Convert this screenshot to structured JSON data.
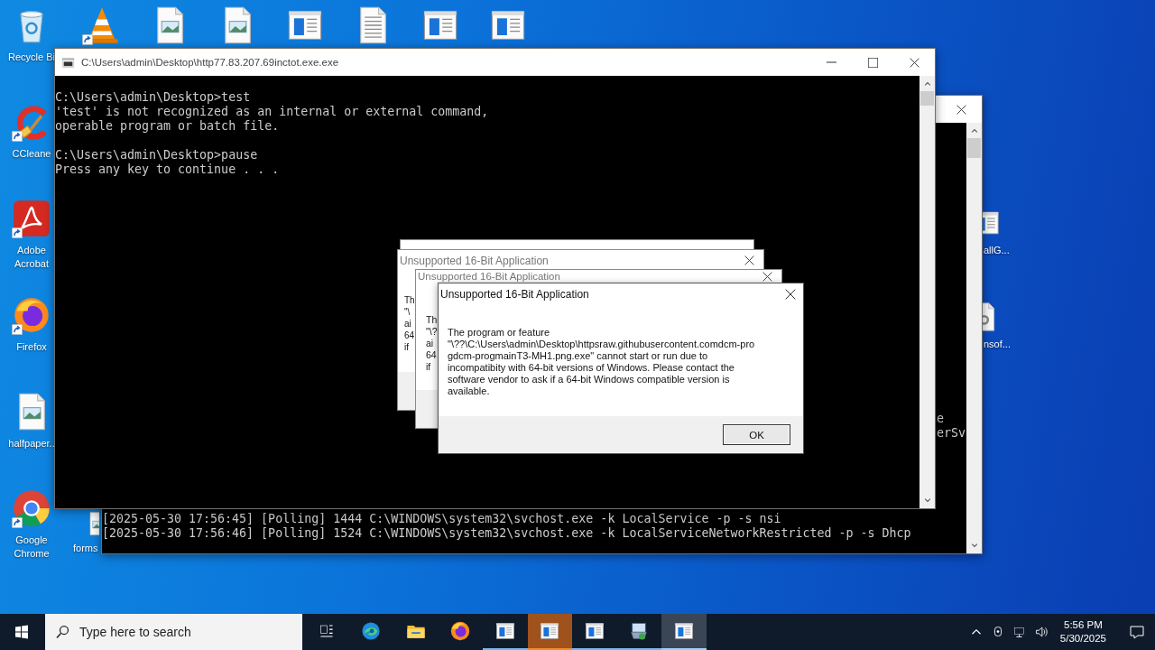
{
  "desktop_icons": [
    {
      "label": "Recycle Bi",
      "kind": "recycle",
      "shortcut": false
    },
    {
      "label": "CCleane",
      "kind": "ccleaner",
      "shortcut": true
    },
    {
      "label": "Adobe Acrobat",
      "kind": "acrobat",
      "shortcut": true
    },
    {
      "label": "Firefox",
      "kind": "firefox",
      "shortcut": true
    },
    {
      "label": "halfpaper..",
      "kind": "image",
      "shortcut": false
    },
    {
      "label": "Google Chrome",
      "kind": "chrome",
      "shortcut": true
    }
  ],
  "top_icons": [
    {
      "kind": "vlc",
      "shortcut": true
    },
    {
      "kind": "image",
      "shortcut": false
    },
    {
      "kind": "image",
      "shortcut": false
    },
    {
      "kind": "window",
      "shortcut": false
    },
    {
      "kind": "document",
      "shortcut": false
    },
    {
      "kind": "window",
      "shortcut": false
    },
    {
      "kind": "window",
      "shortcut": false
    }
  ],
  "partial_icons": [
    {
      "label": "forms",
      "kind": "image"
    },
    {
      "label": "allG...",
      "kind": "window"
    },
    {
      "label": "nsof...",
      "kind": "settings-file"
    }
  ],
  "back_console": {
    "fragments": [
      "e",
      "erSv"
    ],
    "log_lines": [
      "[2025-05-30 17:56:45] [Polling] 1444 C:\\WINDOWS\\system32\\svchost.exe -k LocalService -p -s nsi",
      "[2025-05-30 17:56:46] [Polling] 1524 C:\\WINDOWS\\system32\\svchost.exe -k LocalServiceNetworkRestricted -p -s Dhcp"
    ]
  },
  "console": {
    "title": "C:\\Users\\admin\\Desktop\\http77.83.207.69inctot.exe.exe",
    "blocks": [
      [
        "C:\\Users\\admin\\Desktop>test",
        "'test' is not recognized as an internal or external command,",
        "operable program or batch file."
      ],
      [
        "C:\\Users\\admin\\Desktop>pause",
        "Press any key to continue . . ."
      ]
    ]
  },
  "dialogs": [
    {
      "title": "Unsupported 16-Bit Application",
      "fragments": [
        "Th",
        "\"\\",
        "ai",
        "64",
        "if"
      ]
    },
    {
      "title": "Unsupported 16-Bit Application",
      "fragments": [
        "Th",
        "\"\\?",
        "ai",
        "64",
        "if"
      ]
    }
  ],
  "alert": {
    "title": "Unsupported 16-Bit Application",
    "message_lines": [
      "The program or feature",
      "\"\\??\\C:\\Users\\admin\\Desktop\\httpsraw.githubusercontent.comdcm-pro",
      "gdcm-progmainT3-MH1.png.exe\" cannot start or run due to",
      "incompatibity with 64-bit versions of Windows. Please contact the",
      "software vendor to ask if a 64-bit Windows compatible version is",
      "available."
    ],
    "button": "OK"
  },
  "taskbar": {
    "search": {
      "placeholder": "Type here to search"
    },
    "items": [
      {
        "kind": "task-view",
        "running": false,
        "flashing": false,
        "selected": false
      },
      {
        "kind": "edge",
        "running": false,
        "flashing": false,
        "selected": false
      },
      {
        "kind": "explorer",
        "running": false,
        "flashing": false,
        "selected": false
      },
      {
        "kind": "firefox",
        "running": false,
        "flashing": false,
        "selected": false
      },
      {
        "kind": "window",
        "running": true,
        "flashing": false,
        "selected": false
      },
      {
        "kind": "window",
        "running": true,
        "flashing": true,
        "selected": false
      },
      {
        "kind": "window",
        "running": true,
        "flashing": false,
        "selected": false
      },
      {
        "kind": "installer",
        "running": true,
        "flashing": false,
        "selected": false
      },
      {
        "kind": "window",
        "running": true,
        "flashing": false,
        "selected": true
      }
    ],
    "clock": {
      "time": "5:56 PM",
      "date": "5/30/2025"
    }
  }
}
